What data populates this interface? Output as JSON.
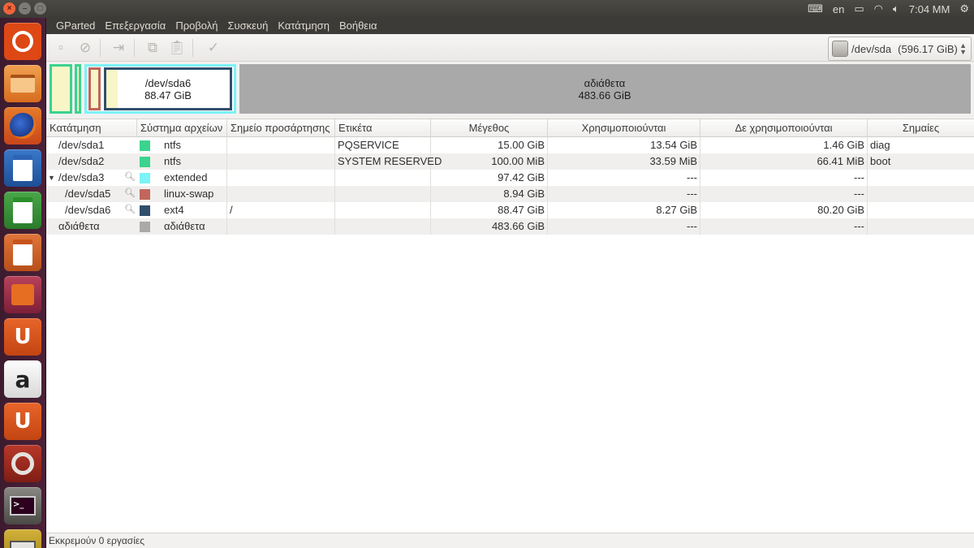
{
  "window_buttons": {
    "close": "×",
    "min": "–",
    "max": "□"
  },
  "menu": [
    "GParted",
    "Επεξεργασία",
    "Προβολή",
    "Συσκευή",
    "Κατάτμηση",
    "Βοήθεια"
  ],
  "indicators": {
    "keyboard": "en",
    "time": "7:04 MM"
  },
  "device": {
    "name": "/dev/sda",
    "size": "(596.17 GiB)"
  },
  "graph": {
    "sda6": {
      "name": "/dev/sda6",
      "size": "88.47 GiB"
    },
    "unallocated": {
      "name": "αδιάθετα",
      "size": "483.66 GiB"
    }
  },
  "columns": [
    "Κατάτμηση",
    "Σύστημα αρχείων",
    "Σημείο προσάρτησης",
    "Ετικέτα",
    "Μέγεθος",
    "Χρησιμοποιούνται",
    "Δε χρησιμοποιούνται",
    "Σημαίες"
  ],
  "rows": [
    {
      "partition": "/dev/sda1",
      "fs": "ntfs",
      "mount": "",
      "label": "PQSERVICE",
      "size": "15.00 GiB",
      "used": "13.54 GiB",
      "unused": "1.46 GiB",
      "flags": "diag",
      "color": "#3bd38e"
    },
    {
      "partition": "/dev/sda2",
      "fs": "ntfs",
      "mount": "",
      "label": "SYSTEM RESERVED",
      "size": "100.00 MiB",
      "used": "33.59 MiB",
      "unused": "66.41 MiB",
      "flags": "boot",
      "color": "#3bd38e"
    },
    {
      "partition": "/dev/sda3",
      "fs": "extended",
      "mount": "",
      "label": "",
      "size": "97.42 GiB",
      "used": "---",
      "unused": "---",
      "flags": "",
      "color": "#7bf3f7"
    },
    {
      "partition": "/dev/sda5",
      "fs": "linux-swap",
      "mount": "",
      "label": "",
      "size": "8.94 GiB",
      "used": "---",
      "unused": "---",
      "flags": "",
      "color": "#c1665a"
    },
    {
      "partition": "/dev/sda6",
      "fs": "ext4",
      "mount": "/",
      "label": "",
      "size": "88.47 GiB",
      "used": "8.27 GiB",
      "unused": "80.20 GiB",
      "flags": "",
      "color": "#314e6c"
    },
    {
      "partition": "αδιάθετα",
      "fs": "αδιάθετα",
      "mount": "",
      "label": "",
      "size": "483.66 GiB",
      "used": "---",
      "unused": "---",
      "flags": "",
      "color": "#a9a9a9"
    }
  ],
  "status": "Εκκρεμούν 0 εργασίες"
}
